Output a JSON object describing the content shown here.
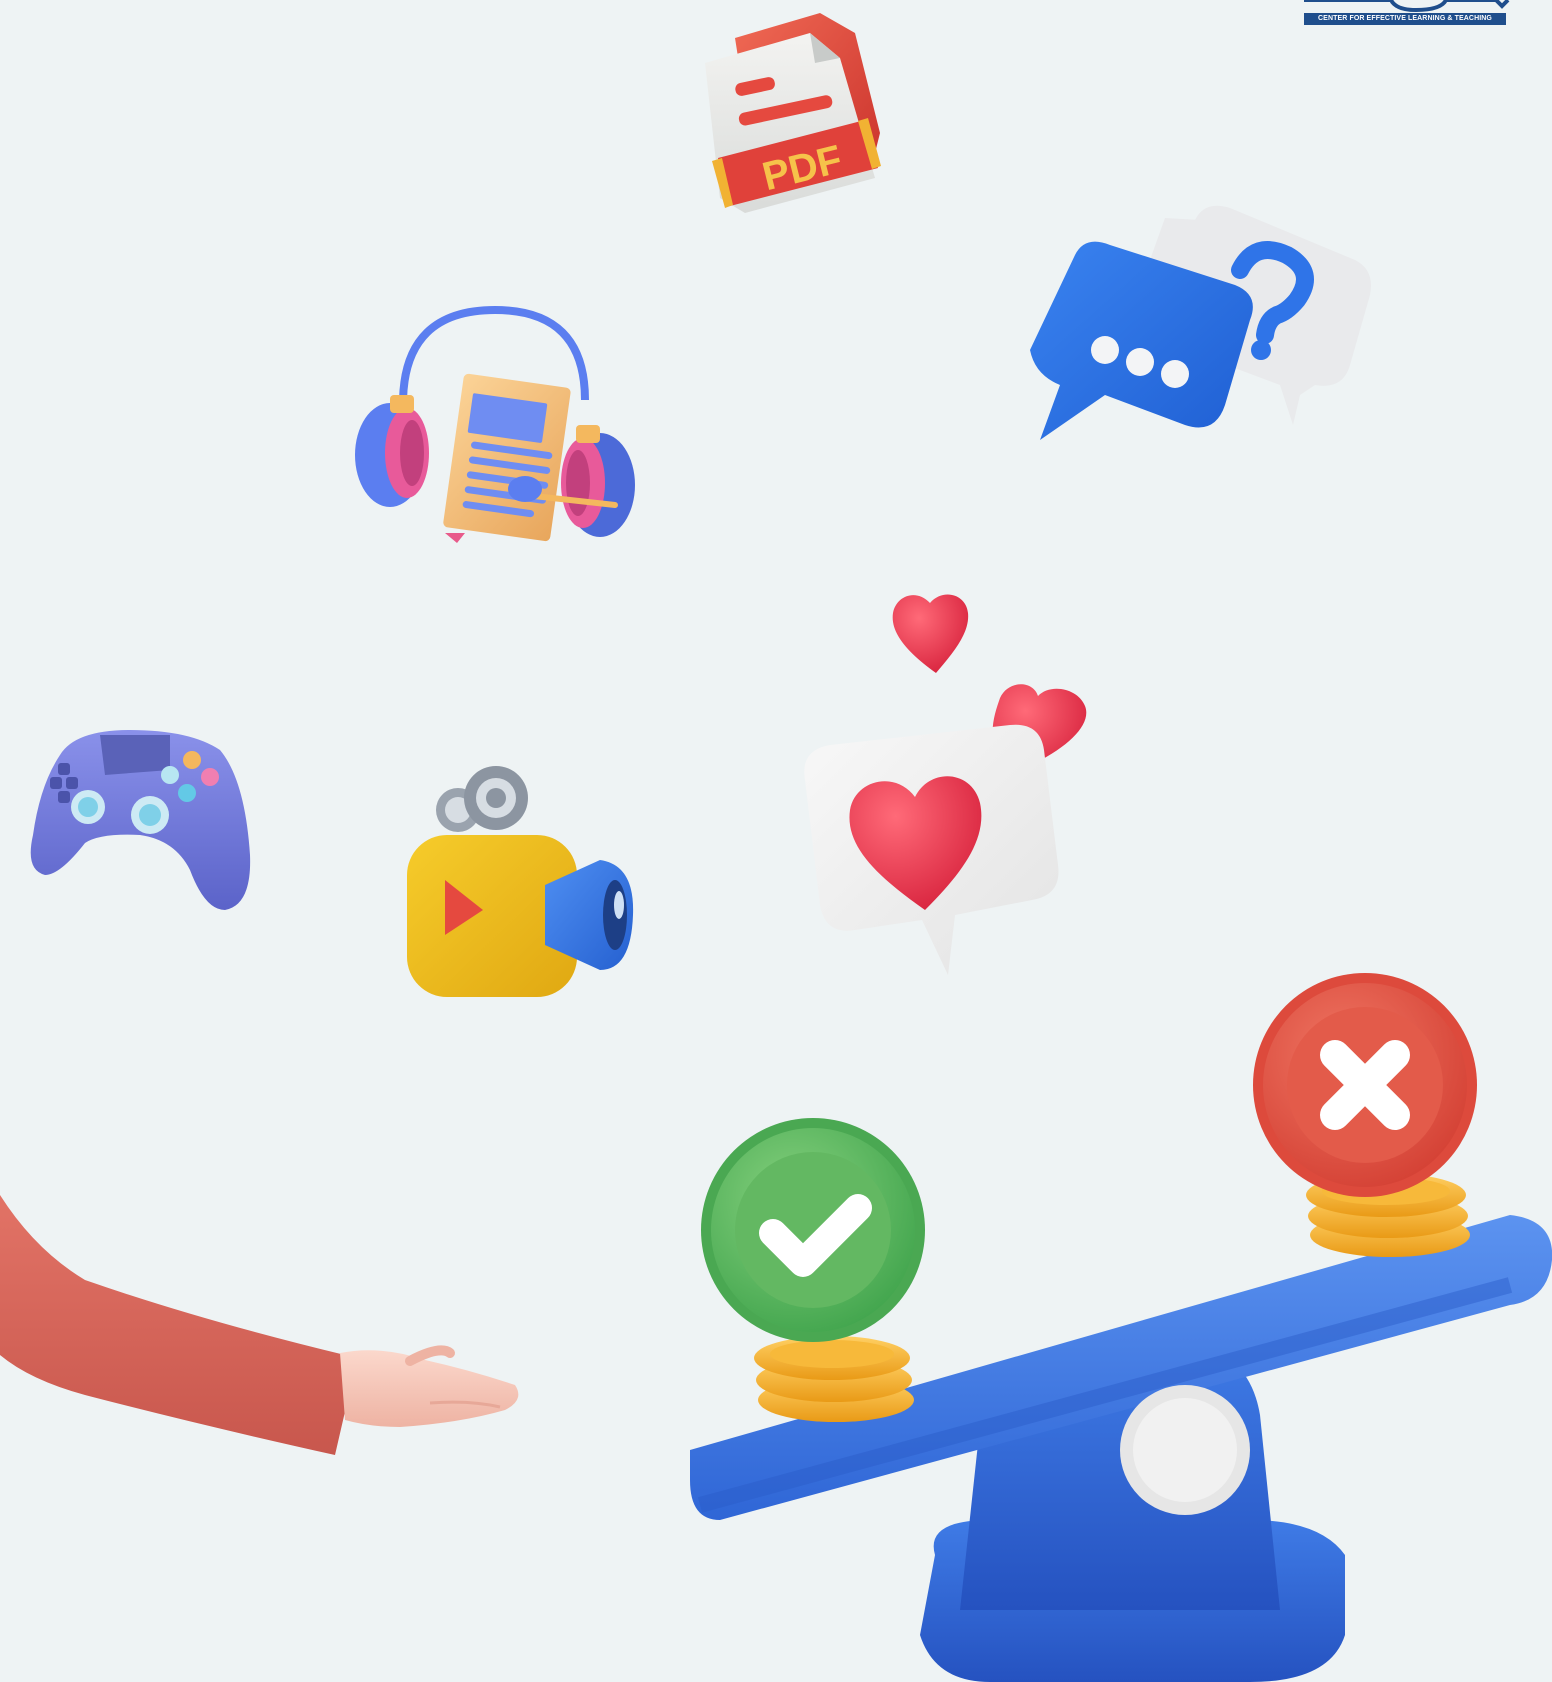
{
  "logo": {
    "text": "CENTER FOR EFFECTIVE LEARNING & TEACHING"
  },
  "pdf_icon": {
    "label": "PDF"
  },
  "icons": [
    "pdf-file-icon",
    "chat-question-icon",
    "audiobook-headphones-icon",
    "hearts-icon",
    "heart-message-icon",
    "game-controller-icon",
    "video-camera-icon",
    "open-hand-icon",
    "seesaw-balance-icon",
    "check-coin-icon",
    "x-coin-icon"
  ],
  "colors": {
    "background": "#eef3f4",
    "blue": "#3f7be6",
    "red": "#e5493f",
    "green": "#5cb85c",
    "gold": "#f2b632",
    "purple": "#7680dc",
    "sleeve": "#d9685e",
    "skin": "#f6c7b8"
  }
}
